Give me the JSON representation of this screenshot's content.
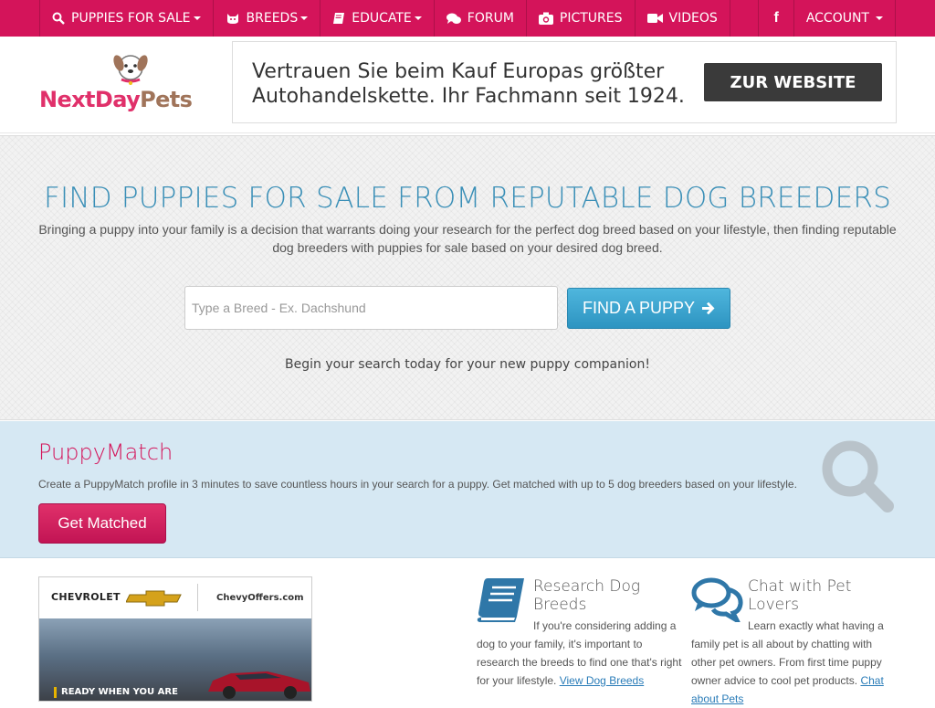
{
  "nav": {
    "items": [
      {
        "label": "PUPPIES FOR SALE",
        "icon": "search-icon",
        "dropdown": true
      },
      {
        "label": "BREEDS",
        "icon": "dog-face-icon",
        "dropdown": true
      },
      {
        "label": "EDUCATE",
        "icon": "book-icon",
        "dropdown": true
      },
      {
        "label": "FORUM",
        "icon": "chat-bubbles-icon",
        "dropdown": false
      },
      {
        "label": "PICTURES",
        "icon": "camera-icon",
        "dropdown": false
      },
      {
        "label": "VIDEOS",
        "icon": "video-camera-icon",
        "dropdown": false
      }
    ],
    "facebook": "f",
    "account": "ACCOUNT"
  },
  "logo": {
    "part1": "NextDay",
    "part2": "Pets"
  },
  "ad": {
    "line1": "Vertrauen Sie beim Kauf Europas größter",
    "line2": "Autohandelskette. Ihr Fachmann seit 1924.",
    "button": "ZUR WEBSITE"
  },
  "hero": {
    "title": "FIND PUPPIES FOR SALE FROM REPUTABLE DOG BREEDERS",
    "description": "Bringing a puppy into your family is a decision that warrants doing your research for the perfect dog breed based on your lifestyle, then finding reputable dog breeders with puppies for sale based on your desired dog breed.",
    "search_placeholder": "Type a Breed - Ex. Dachshund",
    "button": "FIND A PUPPY",
    "subtitle": "Begin your search today for your new puppy companion!"
  },
  "match": {
    "title": "PuppyMatch",
    "description": "Create a PuppyMatch profile in 3 minutes to save countless hours in your search for a puppy. Get matched with up to 5 dog breeders based on your lifestyle.",
    "button": "Get Matched"
  },
  "car_ad": {
    "brand": "CHEVROLET",
    "site": "ChevyOffers.com",
    "tagline": "READY WHEN YOU ARE"
  },
  "features": [
    {
      "title": "Research Dog Breeds",
      "text": "If you're considering adding a dog to your family, it's important to research the breeds to find one that's right for your lifestyle.",
      "link": "View Dog Breeds"
    },
    {
      "title": "Chat with Pet Lovers",
      "text": "Learn exactly what having a family pet is all about by chatting with other pet owners. From first time puppy owner advice to cool pet products.",
      "link": "Chat about Pets"
    }
  ],
  "colors": {
    "primary": "#d4145a",
    "accent": "#39a3cf",
    "match_bg": "#d6e8f3"
  }
}
